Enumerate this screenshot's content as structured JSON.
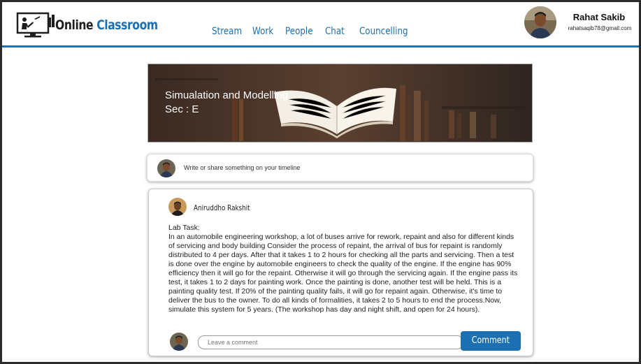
{
  "app": {
    "brand_part1": "Online",
    "brand_part2": "Classroom"
  },
  "nav": {
    "items": [
      {
        "label": "Stream"
      },
      {
        "label": "Work"
      },
      {
        "label": "People"
      },
      {
        "label": "Chat"
      },
      {
        "label": "Councelling"
      }
    ]
  },
  "user": {
    "name": "Rahat Sakib",
    "email": "rahatsaqib78@gmail.com"
  },
  "course": {
    "title": "Simualation and Modelling",
    "section": "Sec : E"
  },
  "share": {
    "placeholder": "Write or share something on your timeline"
  },
  "post": {
    "author": "Aniruddho Rakshit",
    "label": "Lab Task:",
    "body": "In an automobile engineering workshop, a lot of buses arrive for rework, repaint and also for different kinds of servicing and body building Consider the process of repaint, the arrival of bus for repaint is randomly distributed to 4 per days. After that it takes 1 to 2 hours for checking all the parts and servicing. Then a test is done over the engine by automobile engineers to check the quality of the engine. If the engine has 90% efficiency then it will go for the repaint. Otherwise it will go through the servicing again. If the engine pass its test, it takes 1 to 2 days for painting work. Once the painting is done, another test will be held. This is a painting quality test. If 20% of the painting quality fails, it will go for repaint again. Otherwise, it's time to deliver the bus to the owner. To do all kinds of formalities, it takes 2 to 5 hours to end the process.Now, simulate this system for 5 years. (The workshop has day and night shift, and open for 24 hours).",
    "comment_placeholder": "Leave a comment",
    "comment_button": "Comment"
  },
  "colors": {
    "accent": "#1c6fb0",
    "brand_dark": "#1f1f1f"
  }
}
